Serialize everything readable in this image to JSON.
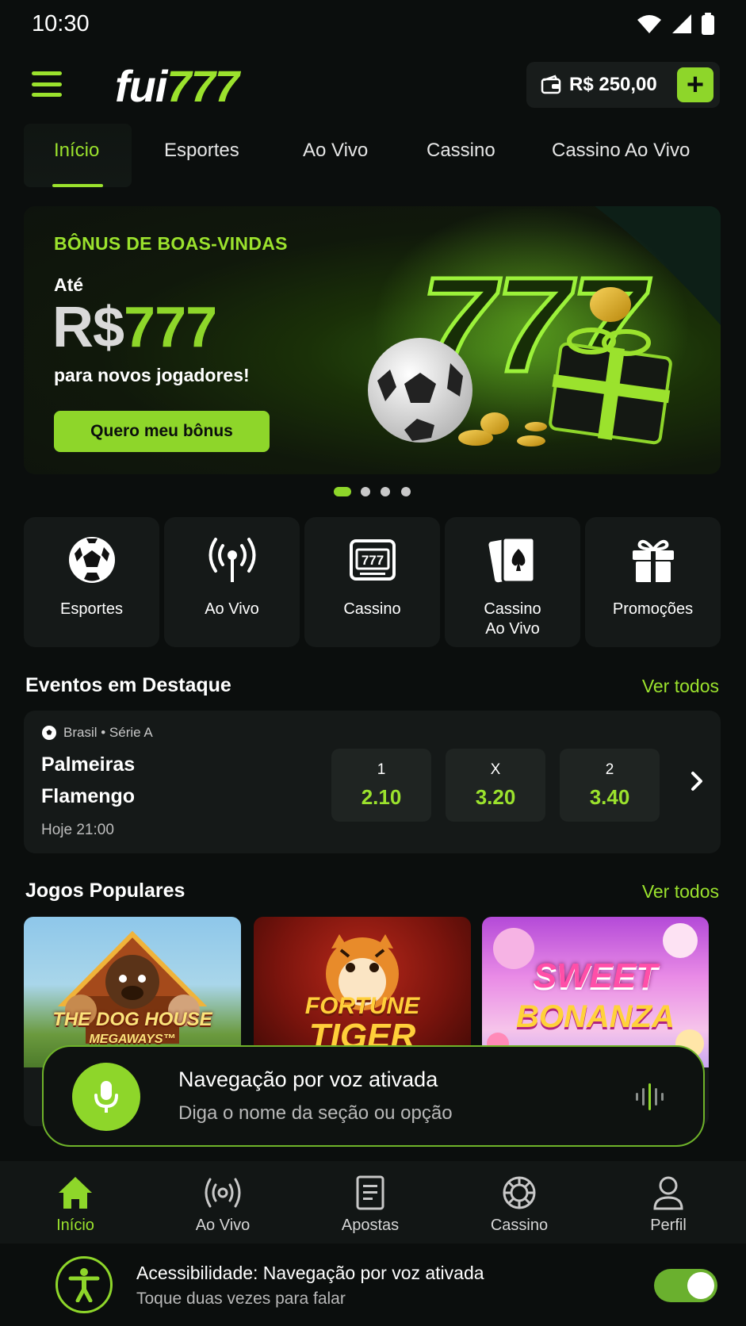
{
  "status_bar": {
    "time": "10:30"
  },
  "header": {
    "logo_white": "fui",
    "logo_green": "777",
    "balance": "R$ 250,00",
    "add_label": "+"
  },
  "top_tabs": [
    {
      "label": "Início",
      "active": true
    },
    {
      "label": "Esportes"
    },
    {
      "label": "Ao Vivo"
    },
    {
      "label": "Cassino"
    },
    {
      "label": "Cassino Ao Vivo"
    }
  ],
  "banner": {
    "eyebrow": "BÔNUS DE BOAS-VINDAS",
    "prefix": "Até",
    "currency": "R$",
    "amount": "777",
    "subtitle": "para novos jogadores!",
    "cta": "Quero meu bônus",
    "art_numbers": "777",
    "carousel_total": 4,
    "carousel_active": 1
  },
  "categories": [
    {
      "label": "Esportes",
      "icon": "soccer-ball-icon"
    },
    {
      "label": "Ao Vivo",
      "icon": "broadcast-icon"
    },
    {
      "label": "Cassino",
      "icon": "slot-machine-icon"
    },
    {
      "label": "Cassino\nAo Vivo",
      "icon": "playing-cards-icon"
    },
    {
      "label": "Promoções",
      "icon": "gift-icon"
    }
  ],
  "featured": {
    "title": "Eventos em Destaque",
    "see_all": "Ver todos",
    "event": {
      "league": "Brasil • Série A",
      "home": "Palmeiras",
      "away": "Flamengo",
      "time": "Hoje 21:00",
      "odds": [
        {
          "label": "1",
          "value": "2.10"
        },
        {
          "label": "X",
          "value": "3.20"
        },
        {
          "label": "2",
          "value": "3.40"
        }
      ]
    }
  },
  "popular": {
    "title": "Jogos Populares",
    "see_all": "Ver todos",
    "games": [
      {
        "title_line1": "THE DOG HOUSE",
        "title_line2": "MEGAWAYS™"
      },
      {
        "title_line1": "FORTUNE",
        "title_line2": "TIGER"
      },
      {
        "title_line1": "SWEET",
        "title_line2": "BONANZA"
      }
    ]
  },
  "voice": {
    "title": "Navegação por voz ativada",
    "subtitle": "Diga o nome da seção ou opção"
  },
  "bottom_nav": [
    {
      "label": "Início",
      "icon": "home-icon",
      "active": true
    },
    {
      "label": "Ao Vivo",
      "icon": "broadcast-icon"
    },
    {
      "label": "Apostas",
      "icon": "bet-slip-icon"
    },
    {
      "label": "Cassino",
      "icon": "casino-chip-icon"
    },
    {
      "label": "Perfil",
      "icon": "user-icon"
    }
  ],
  "accessibility": {
    "title": "Acessibilidade: Navegação por voz ativada",
    "subtitle": "Toque duas vezes para falar",
    "toggle_on": true
  },
  "colors": {
    "accent": "#8ed62a",
    "background": "#0b0e0d",
    "card": "#151918"
  }
}
